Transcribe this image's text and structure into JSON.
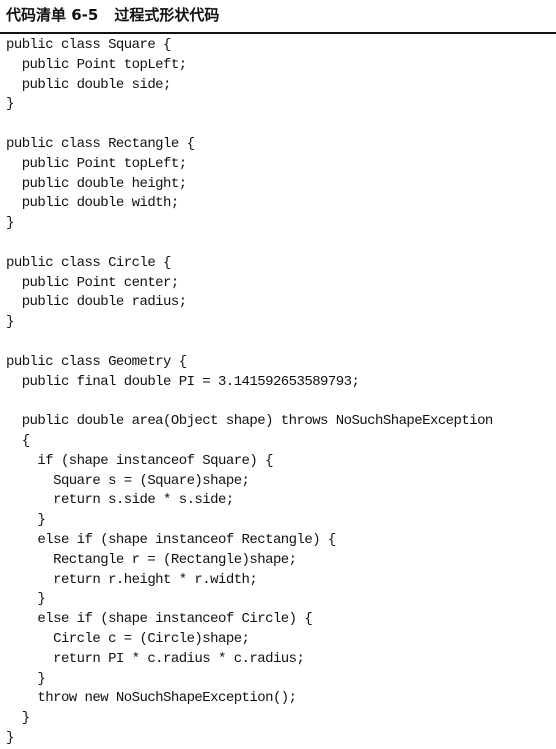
{
  "listing": {
    "number": "代码清单 6-5",
    "title": "过程式形状代码"
  },
  "code_lines": [
    "public class Square {",
    "  public Point topLeft;",
    "  public double side;",
    "}",
    "",
    "public class Rectangle {",
    "  public Point topLeft;",
    "  public double height;",
    "  public double width;",
    "}",
    "",
    "public class Circle {",
    "  public Point center;",
    "  public double radius;",
    "}",
    "",
    "public class Geometry {",
    "  public final double PI = 3.141592653589793;",
    "",
    "  public double area(Object shape) throws NoSuchShapeException",
    "  {",
    "    if (shape instanceof Square) {",
    "      Square s = (Square)shape;",
    "      return s.side * s.side;",
    "    }",
    "    else if (shape instanceof Rectangle) {",
    "      Rectangle r = (Rectangle)shape;",
    "      return r.height * r.width;",
    "    }",
    "    else if (shape instanceof Circle) {",
    "      Circle c = (Circle)shape;",
    "      return PI * c.radius * c.radius;",
    "    }",
    "    throw new NoSuchShapeException();",
    "  }",
    "}"
  ]
}
